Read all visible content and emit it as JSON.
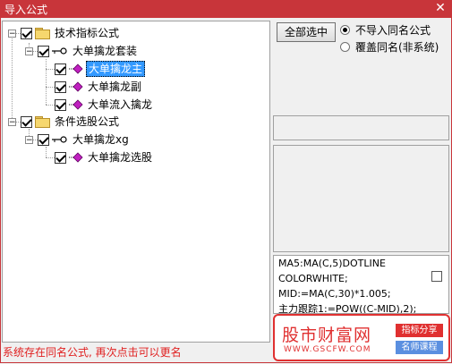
{
  "window": {
    "title": "导入公式",
    "close_glyph": "✕"
  },
  "tree": {
    "groups": [
      {
        "label": "技术指标公式",
        "expander": "−",
        "children": [
          {
            "label": "大单擒龙套装",
            "expander": "−",
            "items": [
              "大单擒龙主",
              "大单擒龙副",
              "大单流入擒龙"
            ]
          }
        ]
      },
      {
        "label": "条件选股公式",
        "expander": "−",
        "children": [
          {
            "label": "大单擒龙xg",
            "expander": "−",
            "items": [
              "大单擒龙选股"
            ]
          }
        ]
      }
    ],
    "selected_item": "大单擒龙主"
  },
  "controls": {
    "select_all_label": "全部选中",
    "radio_no_import": "不导入同名公式",
    "radio_overwrite": "覆盖同名(非系统)",
    "selected_radio": "no_import"
  },
  "code_preview": {
    "lines": [
      "MA5:MA(C,5)DOTLINE",
      "COLORWHITE;",
      "MID:=MA(C,30)*1.005;",
      "主力跟踪1:=POW((C-MID),2);"
    ]
  },
  "status": "系统存在同名公式, 再次点击可以更名",
  "watermark": {
    "site": "股市财富网",
    "url": "WWW.GSCFW.COM",
    "tag1": "指标分享",
    "tag2": "名师课程"
  },
  "colors": {
    "title_bar": "#c8353a",
    "selection": "#3399ff",
    "status": "#e02020",
    "watermark_red": "#e03030",
    "watermark_blue": "#5a8fe0"
  }
}
